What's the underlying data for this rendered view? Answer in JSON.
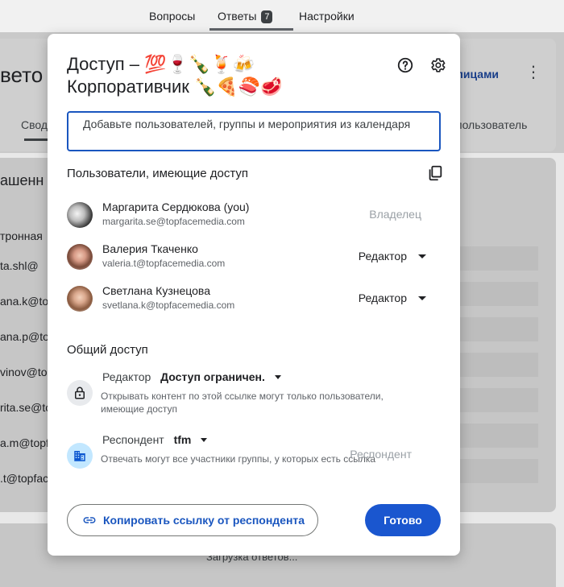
{
  "background": {
    "tabs": [
      {
        "label": "Вопросы"
      },
      {
        "label": "Ответы",
        "badge": "7"
      },
      {
        "label": "Настройки"
      }
    ],
    "title_fragment": "вето",
    "link_fragment": "лицами",
    "svod_fragment": "Свод",
    "user_fragment": "пользователь",
    "list_title_fragment": "ашенн",
    "rows": [
      "тронная",
      "ta.shl@",
      "ana.k@top",
      "ana.p@to",
      "vinov@top",
      "rita.se@to",
      "a.m@topf",
      ".t@topfac"
    ],
    "loading": "Загрузка ответов..."
  },
  "dialog": {
    "title_line1": "Доступ – 💯🍷🍾🍹🍻",
    "title_line2": "Корпоративчик 🍾🍕🍣🥩",
    "help_icon": "help-circle-icon",
    "settings_icon": "gear-icon",
    "search_placeholder": "Добавьте пользователей, группы и мероприятия из календаря",
    "users_section_title": "Пользователи, имеющие доступ",
    "users": [
      {
        "name": "Маргарита Сердюкова (you)",
        "email": "margarita.se@topfacemedia.com",
        "role": "Владелец"
      },
      {
        "name": "Валерия Ткаченко",
        "email": "valeria.t@topfacemedia.com",
        "role": "Редактор"
      },
      {
        "name": "Светлана Кузнецова",
        "email": "svetlana.k@topfacemedia.com",
        "role": "Редактор"
      }
    ],
    "general_section_title": "Общий доступ",
    "editor_access": {
      "label": "Редактор",
      "value": "Доступ ограничен.",
      "description": "Открывать контент по этой ссылке могут только пользователи, имеющие доступ"
    },
    "respondent_access": {
      "label": "Респондент",
      "value": "tfm",
      "description": "Отвечать могут все участники группы, у которых есть ссылка",
      "right_label": "Респондент"
    },
    "copy_link_label": "Копировать ссылку от респондента",
    "done_label": "Готово"
  }
}
